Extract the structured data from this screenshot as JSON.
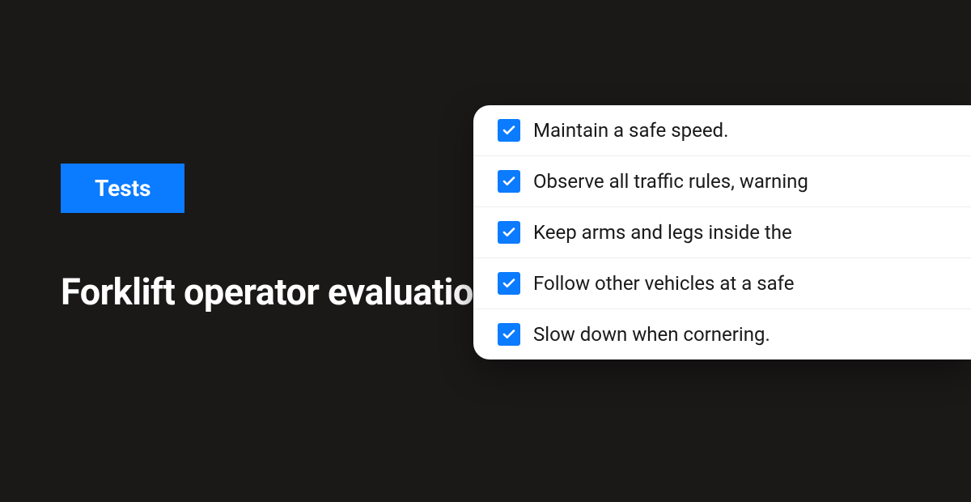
{
  "badge": {
    "label": "Tests"
  },
  "title": "Forklift operator evaluation form",
  "checklist": {
    "items": [
      {
        "label": "Maintain a safe speed.",
        "checked": true
      },
      {
        "label": "Observe all traffic rules, warning",
        "checked": true
      },
      {
        "label": "Keep arms and legs inside the",
        "checked": true
      },
      {
        "label": "Follow other vehicles at a safe",
        "checked": true
      },
      {
        "label": "Slow down when cornering.",
        "checked": true
      }
    ]
  }
}
